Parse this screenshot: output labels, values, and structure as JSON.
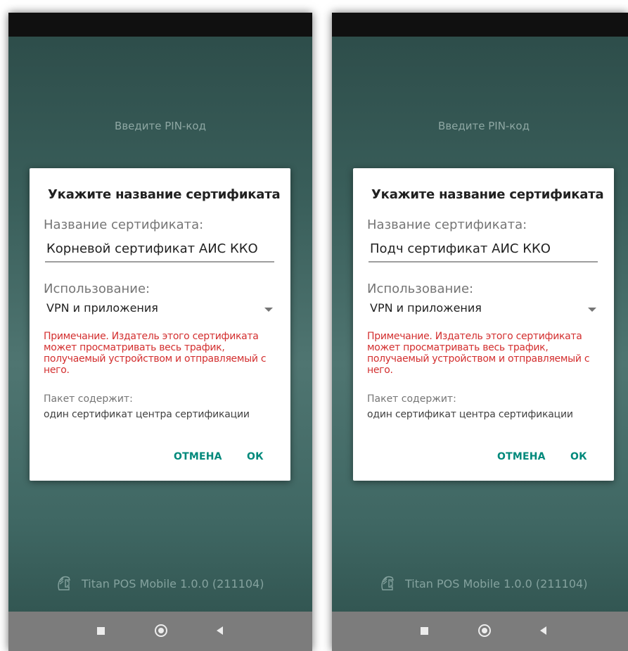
{
  "screens": [
    {
      "pin_prompt": "Введите PIN-код",
      "dialog": {
        "title": "Укажите название сертификата",
        "name_label": "Название сертификата:",
        "name_value": "Корневой сертификат АИС ККО",
        "usage_label": "Использование:",
        "usage_value": "VPN и приложения",
        "warning": "Примечание. Издатель этого сертификата может просматривать весь трафик, получаемый устройством и отправляемый с него.",
        "package_label": "Пакет содержит:",
        "package_content": "один сертификат центра сертификации",
        "cancel_label": "ОТМЕНА",
        "ok_label": "ОК"
      },
      "app_info": "Titan POS Mobile 1.0.0 (211104)",
      "nav_icons": [
        "recents-square-icon",
        "home-circle-icon",
        "back-triangle-icon"
      ]
    },
    {
      "pin_prompt": "Введите PIN-код",
      "dialog": {
        "title": "Укажите название сертификата",
        "name_label": "Название сертификата:",
        "name_value": "Подч сертификат АИС ККО",
        "usage_label": "Использование:",
        "usage_value": "VPN и приложения",
        "warning": "Примечание. Издатель этого сертификата может просматривать весь трафик, получаемый устройством и отправляемый с него.",
        "package_label": "Пакет содержит:",
        "package_content": "один сертификат центра сертификации",
        "cancel_label": "ОТМЕНА",
        "ok_label": "ОК"
      },
      "app_info": "Titan POS Mobile 1.0.0 (211104)",
      "nav_icons": [
        "recents-square-icon",
        "home-circle-icon",
        "back-triangle-icon"
      ]
    }
  ],
  "colors": {
    "accent": "#00897b",
    "warning": "#d32f2f",
    "background_gradient": [
      "#2c4b48",
      "#4f7571",
      "#2d4f4b"
    ],
    "nav_bar": "#7c7c7c"
  }
}
